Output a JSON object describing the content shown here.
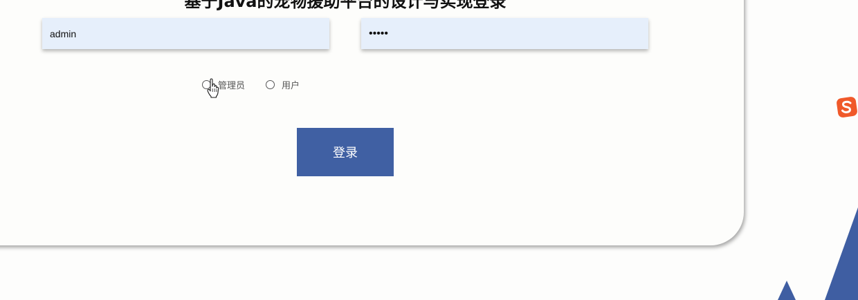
{
  "page": {
    "title": "基于Java的宠物援助平台的设计与实现登录"
  },
  "login_form": {
    "username_value": "admin",
    "password_value": "•••••",
    "roles": [
      {
        "label": "管理员",
        "selected": false
      },
      {
        "label": "用户",
        "selected": false
      }
    ],
    "submit_label": "登录"
  },
  "colors": {
    "accent": "#4060a3",
    "field_bg": "#e6effb",
    "page_bg": "#fdfdfc",
    "sogou_orange": "#f0592a"
  },
  "icons": {
    "cursor": "hand-pointer-icon",
    "tray": "sogou-input-icon"
  }
}
